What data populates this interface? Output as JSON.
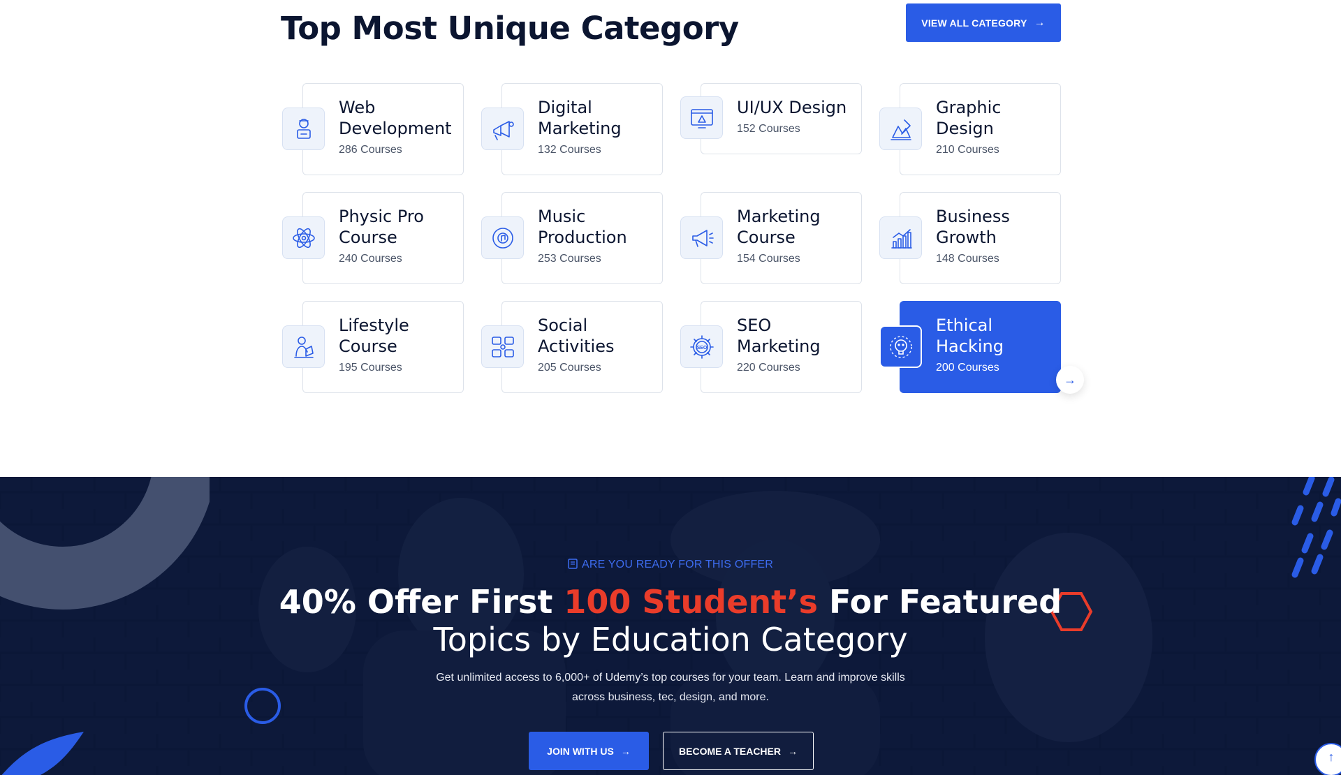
{
  "section": {
    "title": "Top Most Unique Category",
    "view_all_label": "VIEW ALL CATEGORY",
    "categories": [
      {
        "name": "Web Development",
        "count": "286 Courses",
        "icon": "web-developer-icon"
      },
      {
        "name": "Digital Marketing",
        "count": "132 Courses",
        "icon": "digital-marketing-icon"
      },
      {
        "name": "UI/UX Design",
        "count": "152 Courses",
        "icon": "uiux-design-icon"
      },
      {
        "name": "Graphic Design",
        "count": "210 Courses",
        "icon": "graphic-design-icon"
      },
      {
        "name": "Physic Pro Course",
        "count": "240 Courses",
        "icon": "atom-icon"
      },
      {
        "name": "Music Production",
        "count": "253 Courses",
        "icon": "music-disc-icon"
      },
      {
        "name": "Marketing Course",
        "count": "154 Courses",
        "icon": "megaphone-icon"
      },
      {
        "name": "Business Growth",
        "count": "148 Courses",
        "icon": "growth-chart-icon"
      },
      {
        "name": "Lifestyle Course",
        "count": "195 Courses",
        "icon": "lifestyle-icon"
      },
      {
        "name": "Social Activities",
        "count": "205 Courses",
        "icon": "social-network-icon"
      },
      {
        "name": "SEO Marketing",
        "count": "220 Courses",
        "icon": "seo-gear-icon"
      },
      {
        "name": "Ethical Hacking",
        "count": "200 Courses",
        "icon": "hacker-skull-icon",
        "active": true
      }
    ]
  },
  "offer": {
    "kicker": "ARE YOU READY FOR THIS OFFER",
    "title_part1": "40% Offer First ",
    "title_highlight": "100 Student’s",
    "title_part2": " For Featured",
    "title_line2": "Topics by Education Category",
    "description": "Get unlimited access to 6,000+ of Udemy’s top courses for your team. Learn and improve skills across business, tec, design, and more.",
    "join_label": "JOIN WITH US",
    "teacher_label": "BECOME A TEACHER"
  },
  "colors": {
    "accent": "#2a5ce6",
    "highlight": "#ea3c2a",
    "dark_bg": "#0e1a3a"
  }
}
